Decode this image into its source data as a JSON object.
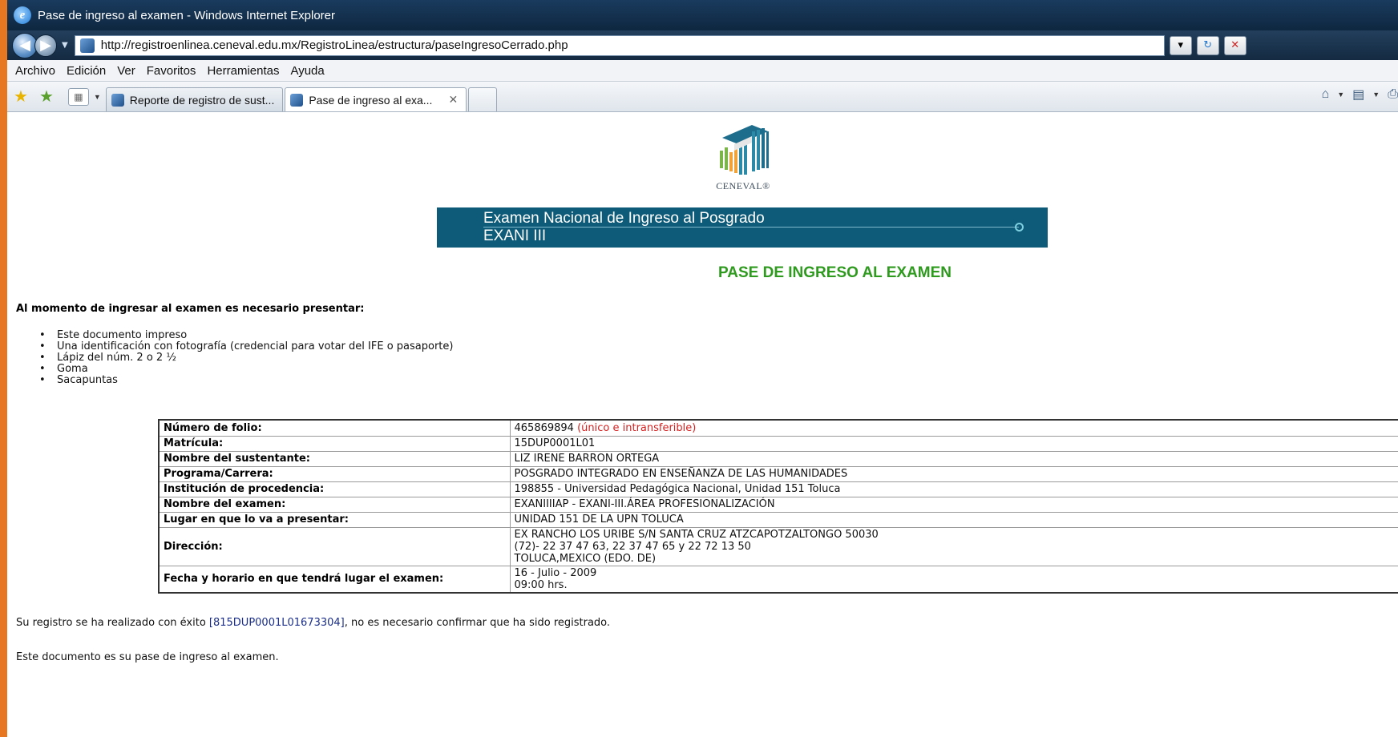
{
  "window": {
    "title": "Pase de ingreso al examen - Windows Internet Explorer",
    "url": "http://registroenlinea.ceneval.edu.mx/RegistroLinea/estructura/paseIngresoCerrado.php"
  },
  "menu": [
    "Archivo",
    "Edición",
    "Ver",
    "Favoritos",
    "Herramientas",
    "Ayuda"
  ],
  "tabs": [
    {
      "label": "Reporte de registro de sust..."
    },
    {
      "label": "Pase de ingreso al exa..."
    }
  ],
  "page": {
    "logo_text": "CENEVAL®",
    "banner_line1": "Examen Nacional de Ingreso al Posgrado",
    "banner_line2": "EXANI III",
    "pass_title": "PASE DE INGRESO AL EXAMEN",
    "intro": "Al momento de ingresar al examen es necesario presentar:",
    "requirements": [
      "Este documento impreso",
      "Una identificación con fotografía (credencial para votar del IFE o pasaporte)",
      "Lápiz del núm. 2 o 2 ½",
      "Goma",
      "Sacapuntas"
    ],
    "fields": {
      "folio_label": "Número de folio:",
      "folio_value": "465869894",
      "folio_note": "(único e intransferible)",
      "matricula_label": "Matrícula:",
      "matricula_value": "15DUP0001L01",
      "nombre_label": "Nombre del sustentante:",
      "nombre_value": "LIZ IRENE BARRON ORTEGA",
      "programa_label": "Programa/Carrera:",
      "programa_value": "POSGRADO INTEGRADO EN ENSEÑANZA DE LAS HUMANIDADES",
      "institucion_label": "Institución de procedencia:",
      "institucion_value": "198855 - Universidad Pedagógica Nacional, Unidad 151 Toluca",
      "examen_label": "Nombre del examen:",
      "examen_value": "EXANIIIIAP - EXANI-III.ÁREA PROFESIONALIZACIÓN",
      "lugar_label": "Lugar en que lo va a presentar:",
      "lugar_value": "UNIDAD 151 DE LA UPN TOLUCA",
      "direccion_label": "Dirección:",
      "direccion_line1": "EX RANCHO LOS URIBE S/N SANTA CRUZ ATZCAPOTZALTONGO 50030",
      "direccion_line2": "(72)- 22 37 47 63, 22 37 47 65 y 22 72 13 50",
      "direccion_line3": "TOLUCA,MEXICO (EDO. DE)",
      "fecha_label": "Fecha y horario en que tendrá lugar el examen:",
      "fecha_line1": "16 - Julio - 2009",
      "fecha_line2": "09:00 hrs."
    },
    "success_pre": "Su registro se ha realizado con éxito ",
    "success_code": "[815DUP0001L01673304]",
    "success_post": ", no es necesario confirmar que ha sido registrado.",
    "closing": "Este documento es su pase de ingreso al examen."
  },
  "colors": {
    "frame": "#e87722",
    "banner": "#0d5b78",
    "pass_title": "#2e9a1e",
    "unique_note": "#d62020"
  },
  "icons": [
    "ie-logo-icon",
    "back-icon",
    "forward-icon",
    "page-icon",
    "refresh-icon",
    "stop-icon",
    "favorites-star-icon",
    "add-favorites-icon",
    "quick-tabs-icon",
    "home-icon",
    "feeds-icon",
    "print-icon"
  ]
}
